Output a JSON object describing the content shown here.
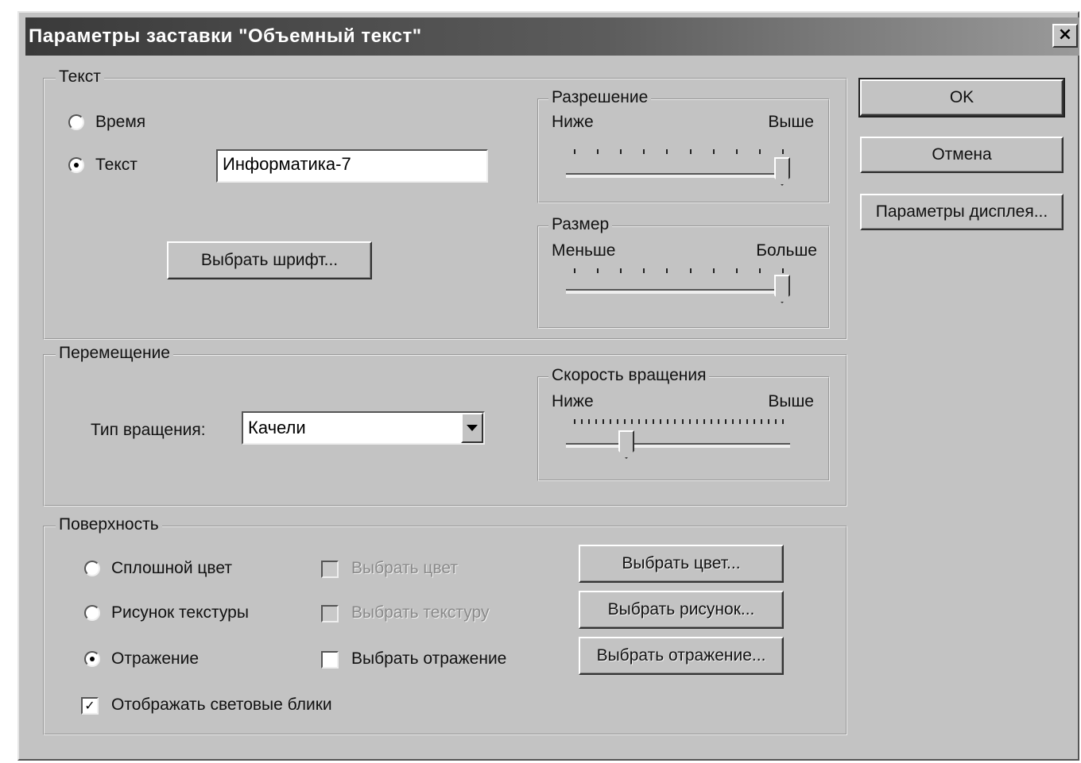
{
  "window": {
    "title": "Параметры заставки \"Объемный текст\"",
    "close_glyph": "×"
  },
  "buttons": {
    "ok": "OK",
    "cancel": "Отмена",
    "display": "Параметры дисплея..."
  },
  "text_group": {
    "legend": "Текст",
    "radio_time": "Время",
    "radio_text": "Текст",
    "selected": "Текст",
    "text_value": "Информатика-7",
    "font_button": "Выбрать шрифт..."
  },
  "resolution": {
    "legend": "Разрешение",
    "low": "Ниже",
    "high": "Выше",
    "level": 1.0
  },
  "size": {
    "legend": "Размер",
    "low": "Меньше",
    "high": "Больше",
    "level": 1.0
  },
  "motion": {
    "legend": "Перемещение",
    "rotation_label": "Тип вращения:",
    "rotation_value": "Качели",
    "speed": {
      "legend": "Скорость вращения",
      "low": "Ниже",
      "high": "Выше",
      "level": 0.25
    }
  },
  "surface": {
    "legend": "Поверхность",
    "radio_solid": "Сплошной цвет",
    "radio_texture": "Рисунок текстуры",
    "radio_reflection": "Отражение",
    "selected": "Отражение",
    "check_color": "Выбрать цвет",
    "check_texture": "Выбрать текстуру",
    "check_reflection": "Выбрать отражение",
    "btn_color": "Выбрать цвет...",
    "btn_texture": "Выбрать рисунок...",
    "btn_reflection": "Выбрать отражение...",
    "highlights": "Отображать световые блики",
    "highlights_checked": true,
    "check_glyph": "✓"
  }
}
